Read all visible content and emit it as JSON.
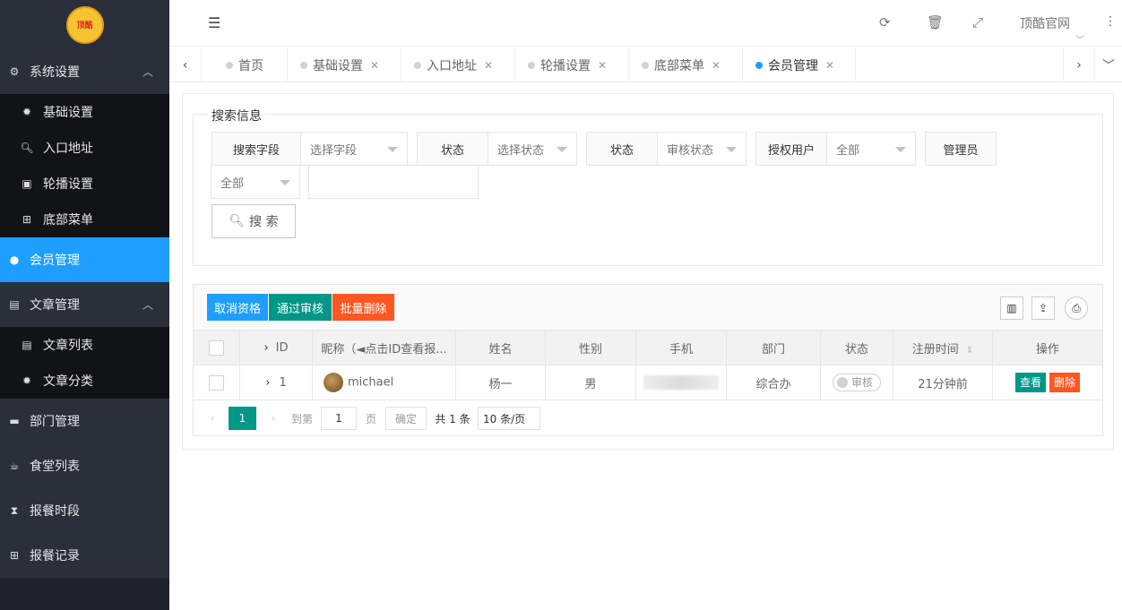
{
  "logo": {
    "text": "顶酷"
  },
  "sidebar": {
    "items": [
      {
        "label": "系统设置",
        "icon": "gears-icon"
      },
      {
        "label": "基础设置",
        "icon": "gear-icon"
      },
      {
        "label": "入口地址",
        "icon": "search-icon"
      },
      {
        "label": "轮播设置",
        "icon": "image-icon"
      },
      {
        "label": "底部菜单",
        "icon": "sitemap-icon"
      },
      {
        "label": "会员管理",
        "icon": "user-icon"
      },
      {
        "label": "文章管理",
        "icon": "list-icon"
      },
      {
        "label": "文章列表",
        "icon": "list-icon"
      },
      {
        "label": "文章分类",
        "icon": "gear-icon"
      },
      {
        "label": "部门管理",
        "icon": "doc-icon"
      },
      {
        "label": "食堂列表",
        "icon": "cup-icon"
      },
      {
        "label": "报餐时段",
        "icon": "hourglass-icon"
      },
      {
        "label": "报餐记录",
        "icon": "table-icon"
      }
    ]
  },
  "topbar": {
    "site_link": "顶酷官网"
  },
  "tabs": [
    {
      "label": "首页"
    },
    {
      "label": "基础设置"
    },
    {
      "label": "入口地址"
    },
    {
      "label": "轮播设置"
    },
    {
      "label": "底部菜单"
    },
    {
      "label": "会员管理"
    }
  ],
  "search": {
    "legend": "搜索信息",
    "field_label": "搜索字段",
    "field_select": "选择字段",
    "status_label": "状态",
    "status_select": "选择状态",
    "status2_label": "状态",
    "status2_select": "审核状态",
    "auth_label": "授权用户",
    "auth_select": "全部",
    "admin_label": "管理员",
    "admin_select": "全部",
    "search_button": "搜 索"
  },
  "toolbar": {
    "cancel": "取消资格",
    "approve": "通过审核",
    "batch_delete": "批量删除"
  },
  "table": {
    "headers": [
      "ID",
      "昵称（◄点击ID查看报...",
      "姓名",
      "性别",
      "手机",
      "部门",
      "状态",
      "注册时间",
      "操作"
    ],
    "rows": [
      {
        "id": "1",
        "nickname": "michael",
        "name": "杨一",
        "gender": "男",
        "dept": "综合办",
        "status": "审核",
        "reg_time": "21分钟前",
        "view": "查看",
        "delete": "删除"
      }
    ]
  },
  "pager": {
    "current": "1",
    "goto_label": "到第",
    "goto_value": "1",
    "page_unit": "页",
    "confirm": "确定",
    "total": "共 1 条",
    "page_size": "10 条/页"
  },
  "colors": {
    "primary": "#1e9fff",
    "green": "#009688",
    "orange": "#ff5722",
    "sidebar": "#20222a"
  }
}
